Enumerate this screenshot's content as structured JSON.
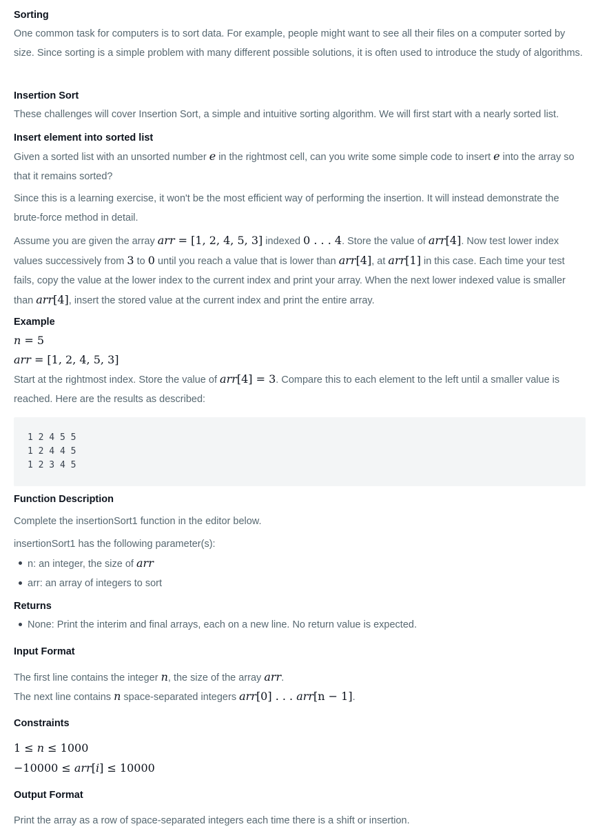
{
  "sorting": {
    "heading": "Sorting",
    "text": "One common task for computers is to sort data. For example, people might want to see all their files on a computer sorted by size. Since sorting is a simple problem with many different possible solutions, it is often used to introduce the study of algorithms."
  },
  "insertion_sort": {
    "heading": "Insertion Sort",
    "text": "These challenges will cover Insertion Sort, a simple and intuitive sorting algorithm. We will first start with a nearly sorted list."
  },
  "insert_element": {
    "heading": "Insert element into sorted list",
    "p1": [
      "Given a sorted list with an unsorted number ",
      " in the rightmost cell, can you write some simple code to insert ",
      " into the array so that it remains sorted?"
    ],
    "var_e": "e",
    "p2": "Since this is a learning exercise, it won't be the most efficient way of performing the insertion. It will instead demonstrate the brute-force method in detail.",
    "p3": [
      "Assume you are given the array ",
      " indexed ",
      ". Store the value of ",
      ". Now test lower index values successively from ",
      " to ",
      " until you reach a value that is lower than ",
      ", at ",
      " in this case. Each time your test fails, copy the value at the lower index to the current index and print your array. When the next lower indexed value is smaller than ",
      ", insert the stored value at the current index and print the entire array."
    ],
    "m_arr_eq": "[1, 2, 4, 5, 3]",
    "m_range": "0 . . . 4",
    "m_idx4": "[4]",
    "m_idx1": "[1]",
    "m_3": "3",
    "m_0": "0"
  },
  "example": {
    "heading": "Example",
    "n_line": "= 5",
    "arr_line": "= [1, 2, 4, 5, 3]",
    "text": [
      "Start at the rightmost index. Store the value of ",
      ". Compare this to each element to the left until a smaller value is reached. Here are the results as described:"
    ],
    "m_store": "[4] = 3",
    "code_lines": [
      "1 2 4 5 5",
      "1 2 4 4 5",
      "1 2 3 4 5"
    ]
  },
  "function_description": {
    "heading": "Function Description",
    "text1": "Complete the insertionSort1 function in the editor below.",
    "text2": "insertionSort1 has the following parameter(s):",
    "params": [
      "n: an integer, the size of ",
      "arr: an array of integers to sort"
    ]
  },
  "returns": {
    "heading": "Returns",
    "items": [
      "None: Print the interim and final arrays, each on a new line. No return value is expected."
    ]
  },
  "input_format": {
    "heading": "Input Format",
    "line1": [
      "The first line contains the integer ",
      ", the size of the array ",
      "."
    ],
    "line2": [
      "The next line contains ",
      " space-separated integers ",
      "."
    ],
    "m_range": "[0] . . . ",
    "m_end": "[n − 1]"
  },
  "constraints": {
    "heading": "Constraints",
    "c1": [
      "1 ≤ ",
      " ≤ 1000"
    ],
    "c2": [
      "−10000 ≤ ",
      "[",
      "] ≤ 10000"
    ]
  },
  "output_format": {
    "heading": "Output Format",
    "text": "Print the array as a row of space-separated integers each time there is a shift or insertion."
  }
}
